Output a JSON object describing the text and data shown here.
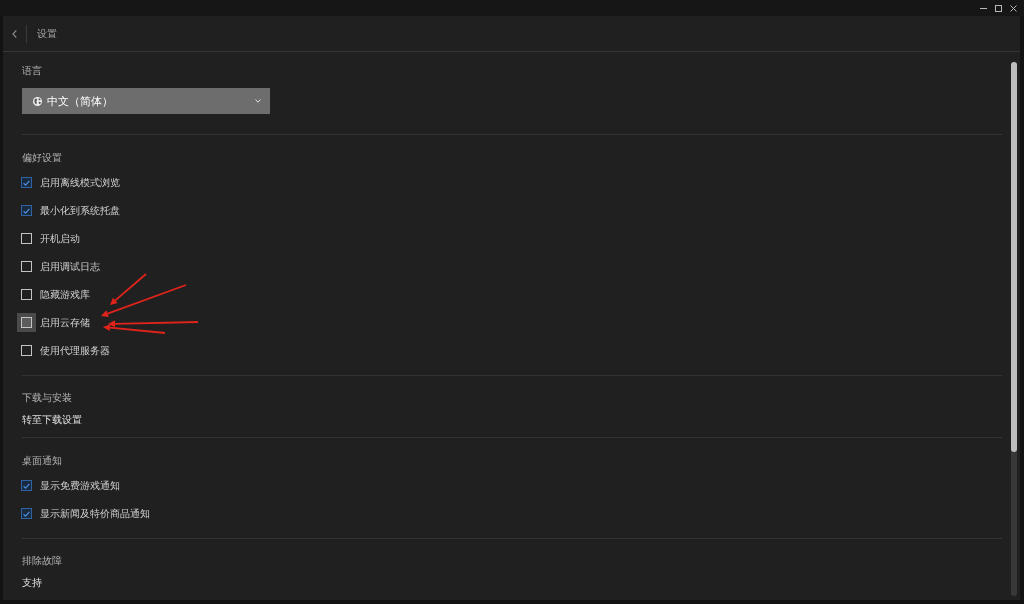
{
  "header": {
    "title": "设置"
  },
  "sections": [
    {
      "kind": "dropdown",
      "label": "语言",
      "value": "中文（简体）"
    },
    {
      "kind": "checkboxes",
      "label": "偏好设置",
      "options": [
        {
          "label": "启用离线模式浏览",
          "checked": true,
          "hovered": false
        },
        {
          "label": "最小化到系统托盘",
          "checked": true,
          "hovered": false
        },
        {
          "label": "开机启动",
          "checked": false,
          "hovered": false
        },
        {
          "label": "启用调试日志",
          "checked": false,
          "hovered": false
        },
        {
          "label": "隐藏游戏库",
          "checked": false,
          "hovered": false
        },
        {
          "label": "启用云存储",
          "checked": false,
          "hovered": true
        },
        {
          "label": "使用代理服务器",
          "checked": false,
          "hovered": false
        }
      ]
    },
    {
      "kind": "link",
      "label": "下载与安装",
      "link": "转至下载设置"
    },
    {
      "kind": "checkboxes",
      "label": "桌面通知",
      "options": [
        {
          "label": "显示免费游戏通知",
          "checked": true,
          "hovered": false
        },
        {
          "label": "显示新闻及特价商品通知",
          "checked": true,
          "hovered": false
        }
      ]
    },
    {
      "kind": "link",
      "label": "排除故障",
      "link": "支持"
    }
  ]
}
